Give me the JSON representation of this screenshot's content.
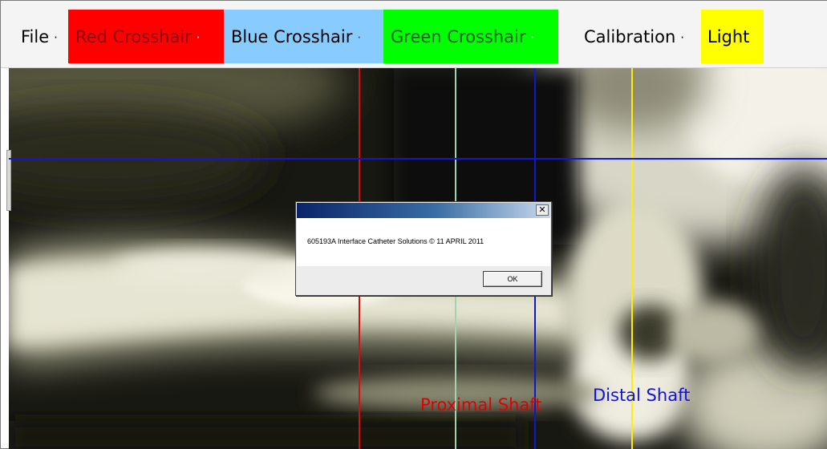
{
  "menubar": {
    "items": [
      {
        "label": "File",
        "arrow": "·"
      },
      {
        "label": "Red Crosshair",
        "arrow": "·",
        "color": "#ff0000"
      },
      {
        "label": "Blue Crosshair",
        "arrow": "·",
        "color": "#88ccff"
      },
      {
        "label": "Green Crosshair",
        "arrow": "·",
        "color": "#00ff00"
      },
      {
        "label": "Calibration",
        "arrow": "·"
      },
      {
        "label": "Light",
        "color": "#ffff00"
      }
    ]
  },
  "overlay": {
    "proximal_label": "Proximal Shaft",
    "distal_label": "Distal Shaft",
    "crosshair_colors": {
      "red": "#d21010",
      "green": "#9fd4b0",
      "blue": "#1018c8",
      "light": "#ffee00"
    }
  },
  "dialog": {
    "title": "",
    "close_glyph": "✕",
    "message": "605193A Interface Catheter Solutions © 11 APRIL 2011",
    "ok_label": "OK"
  }
}
